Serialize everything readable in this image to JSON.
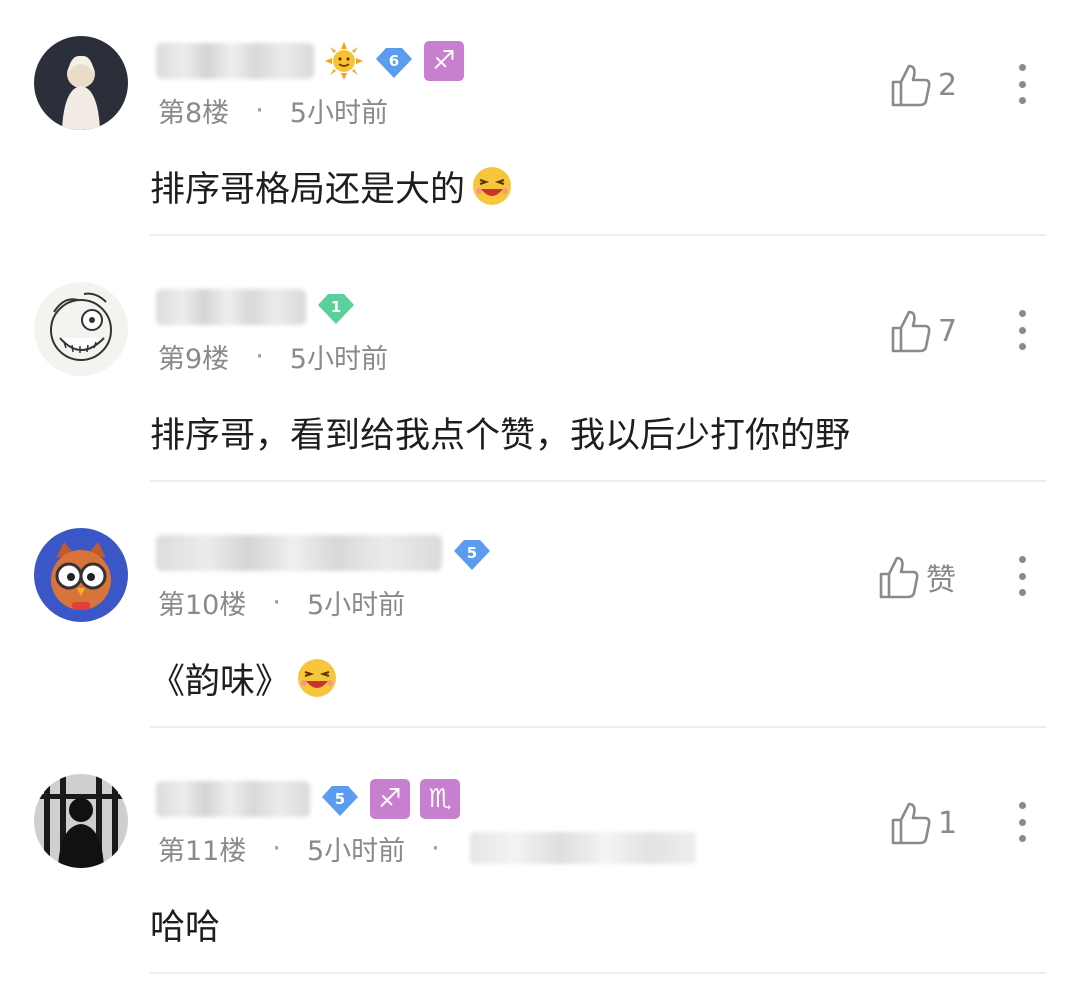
{
  "comments": [
    {
      "floor": "第8楼",
      "time": "5小时前",
      "text": "排序哥格局还是大的",
      "likes": "2",
      "level": "6",
      "level_color": "#5b9cf0",
      "badges": [
        "sun-icon",
        "sagittarius-icon"
      ],
      "zodiac": [
        "♐"
      ],
      "emoji": "laughing-emoji-icon"
    },
    {
      "floor": "第9楼",
      "time": "5小时前",
      "text": "排序哥，看到给我点个赞，我以后少打你的野",
      "likes": "7",
      "level": "1",
      "level_color": "#5bcf9c",
      "badges": [],
      "zodiac": []
    },
    {
      "floor": "第10楼",
      "time": "5小时前",
      "text": "《韵味》",
      "likes": "赞",
      "level": "5",
      "level_color": "#5b9cf0",
      "badges": [],
      "zodiac": [],
      "emoji": "laughing-emoji-icon"
    },
    {
      "floor": "第11楼",
      "time": "5小时前",
      "text": "哈哈",
      "likes": "1",
      "level": "5",
      "level_color": "#5b9cf0",
      "badges": [
        "sagittarius-icon",
        "scorpio-icon"
      ],
      "zodiac": [
        "♐",
        "♏"
      ]
    }
  ],
  "colors": {
    "zodiac_badge": "#c97fcf",
    "meta_text": "#8a8a8a",
    "divider": "#eeeeee"
  },
  "icons": {
    "like": "thumbs-up-icon",
    "more": "more-vertical-icon",
    "separator": "·"
  }
}
